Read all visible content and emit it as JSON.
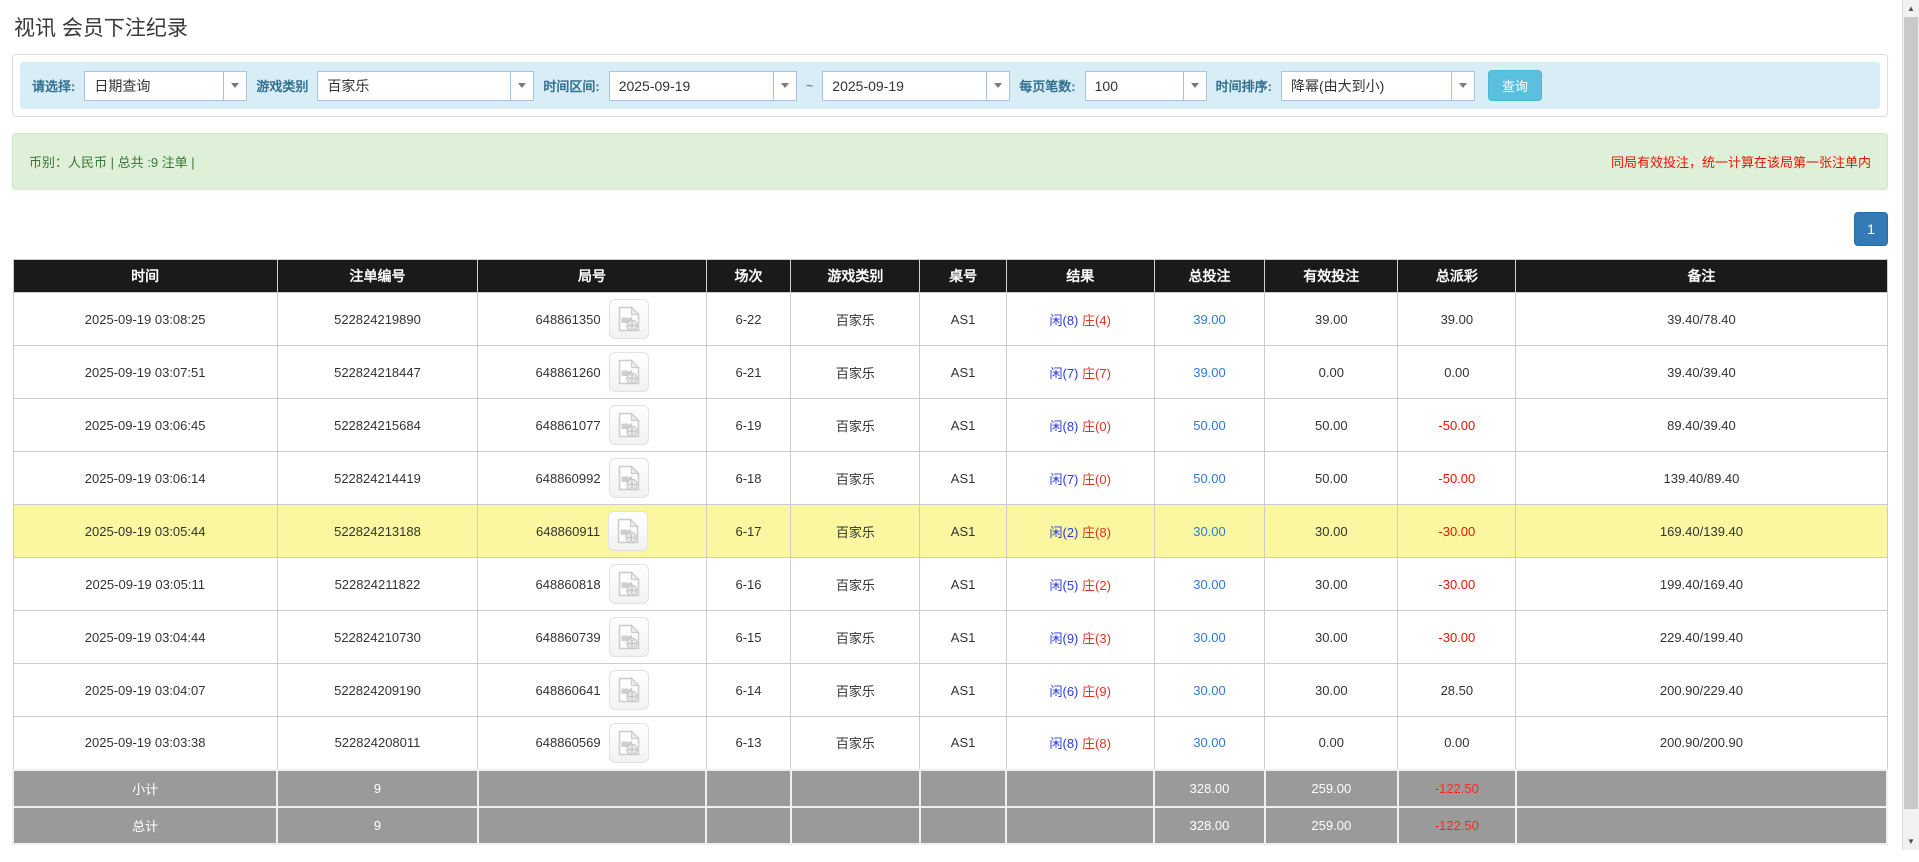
{
  "page": {
    "title": "视讯 会员下注纪录"
  },
  "filters": {
    "select_label": "请选择:",
    "select_value": "日期查询",
    "game_type_label": "游戏类别",
    "game_type_value": "百家乐",
    "date_range_label": "时间区间:",
    "date_from": "2025-09-19",
    "date_separator": "~",
    "date_to": "2025-09-19",
    "page_size_label": "每页笔数:",
    "page_size_value": "100",
    "sort_label": "时间排序:",
    "sort_value": "降幂(由大到小)",
    "search_button": "查询"
  },
  "summary": {
    "left": "币别：人民币 | 总共 :9 注单 |",
    "right_notice": "同局有效投注，统一计算在该局第一张注单内"
  },
  "pagination": {
    "current_page": "1"
  },
  "icons": {
    "video_icon": "video-replay-icon",
    "combo_arrow": "chevron-down-icon",
    "scroll_up": "▲",
    "scroll_down": "▼"
  },
  "table": {
    "headers": [
      "时间",
      "注单编号",
      "局号",
      "场次",
      "游戏类别",
      "桌号",
      "结果",
      "总投注",
      "有效投注",
      "总派彩",
      "备注"
    ],
    "rows": [
      {
        "time": "2025-09-19 03:08:25",
        "bet_id": "522824219890",
        "round_id": "648861350",
        "session": "6-22",
        "game": "百家乐",
        "table_no": "AS1",
        "player": "闲(8)",
        "banker": "庄(4)",
        "total_bet": "39.00",
        "valid_bet": "39.00",
        "payout": "39.00",
        "note": "39.40/78.40",
        "highlight": false
      },
      {
        "time": "2025-09-19 03:07:51",
        "bet_id": "522824218447",
        "round_id": "648861260",
        "session": "6-21",
        "game": "百家乐",
        "table_no": "AS1",
        "player": "闲(7)",
        "banker": "庄(7)",
        "total_bet": "39.00",
        "valid_bet": "0.00",
        "payout": "0.00",
        "note": "39.40/39.40",
        "highlight": false
      },
      {
        "time": "2025-09-19 03:06:45",
        "bet_id": "522824215684",
        "round_id": "648861077",
        "session": "6-19",
        "game": "百家乐",
        "table_no": "AS1",
        "player": "闲(8)",
        "banker": "庄(0)",
        "total_bet": "50.00",
        "valid_bet": "50.00",
        "payout": "-50.00",
        "note": "89.40/39.40",
        "highlight": false
      },
      {
        "time": "2025-09-19 03:06:14",
        "bet_id": "522824214419",
        "round_id": "648860992",
        "session": "6-18",
        "game": "百家乐",
        "table_no": "AS1",
        "player": "闲(7)",
        "banker": "庄(0)",
        "total_bet": "50.00",
        "valid_bet": "50.00",
        "payout": "-50.00",
        "note": "139.40/89.40",
        "highlight": false
      },
      {
        "time": "2025-09-19 03:05:44",
        "bet_id": "522824213188",
        "round_id": "648860911",
        "session": "6-17",
        "game": "百家乐",
        "table_no": "AS1",
        "player": "闲(2)",
        "banker": "庄(8)",
        "total_bet": "30.00",
        "valid_bet": "30.00",
        "payout": "-30.00",
        "note": "169.40/139.40",
        "highlight": true
      },
      {
        "time": "2025-09-19 03:05:11",
        "bet_id": "522824211822",
        "round_id": "648860818",
        "session": "6-16",
        "game": "百家乐",
        "table_no": "AS1",
        "player": "闲(5)",
        "banker": "庄(2)",
        "total_bet": "30.00",
        "valid_bet": "30.00",
        "payout": "-30.00",
        "note": "199.40/169.40",
        "highlight": false
      },
      {
        "time": "2025-09-19 03:04:44",
        "bet_id": "522824210730",
        "round_id": "648860739",
        "session": "6-15",
        "game": "百家乐",
        "table_no": "AS1",
        "player": "闲(9)",
        "banker": "庄(3)",
        "total_bet": "30.00",
        "valid_bet": "30.00",
        "payout": "-30.00",
        "note": "229.40/199.40",
        "highlight": false
      },
      {
        "time": "2025-09-19 03:04:07",
        "bet_id": "522824209190",
        "round_id": "648860641",
        "session": "6-14",
        "game": "百家乐",
        "table_no": "AS1",
        "player": "闲(6)",
        "banker": "庄(9)",
        "total_bet": "30.00",
        "valid_bet": "30.00",
        "payout": "28.50",
        "note": "200.90/229.40",
        "highlight": false
      },
      {
        "time": "2025-09-19 03:03:38",
        "bet_id": "522824208011",
        "round_id": "648860569",
        "session": "6-13",
        "game": "百家乐",
        "table_no": "AS1",
        "player": "闲(8)",
        "banker": "庄(8)",
        "total_bet": "30.00",
        "valid_bet": "0.00",
        "payout": "0.00",
        "note": "200.90/200.90",
        "highlight": false
      }
    ],
    "subtotal": {
      "label": "小计",
      "count": "9",
      "total_bet": "328.00",
      "valid_bet": "259.00",
      "payout": "-122.50"
    },
    "total": {
      "label": "总计",
      "count": "9",
      "total_bet": "328.00",
      "valid_bet": "259.00",
      "payout": "-122.50"
    }
  },
  "colors": {
    "player_blue": "#2b3bd8",
    "banker_red": "#e03325",
    "bet_link_blue": "#2c7bd9",
    "negative_red": "#ee1100",
    "highlight_yellow": "#faf7a0",
    "header_bg": "#1a1a1a",
    "footer_bg": "#9a9a9a",
    "info_bar_bg": "#d9edf7",
    "summary_bg": "#dff0d8",
    "button_cyan": "#5bc0de",
    "pagination_blue": "#337ab7"
  }
}
